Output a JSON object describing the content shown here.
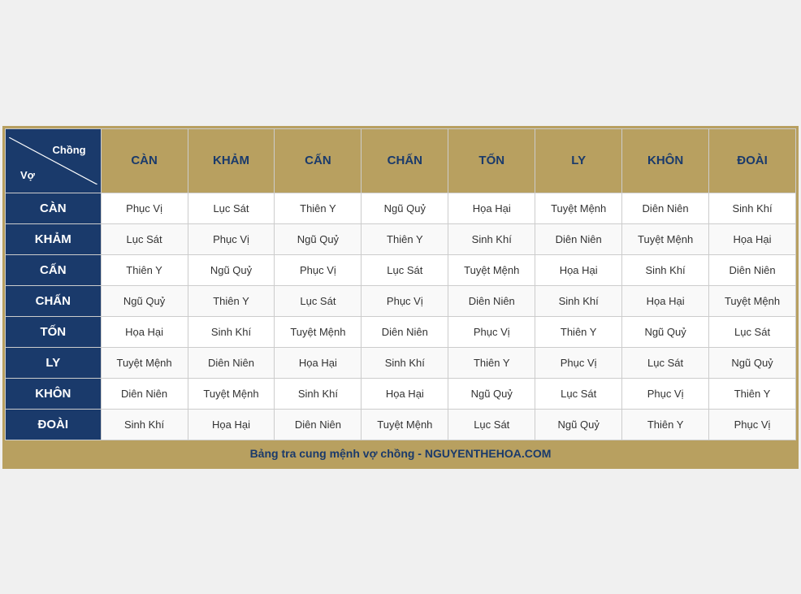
{
  "table": {
    "corner_label_chong": "Chồng",
    "corner_label_vo": "Vợ",
    "col_headers": [
      "CÀN",
      "KHẢM",
      "CẤN",
      "CHẤN",
      "TỐN",
      "LY",
      "KHÔN",
      "ĐOÀI"
    ],
    "row_headers": [
      "CÀN",
      "KHẢM",
      "CẤN",
      "CHẤN",
      "TỐN",
      "LY",
      "KHÔN",
      "ĐOÀI"
    ],
    "rows": [
      [
        "Phục Vị",
        "Lục Sát",
        "Thiên Y",
        "Ngũ Quỷ",
        "Họa Hại",
        "Tuyệt Mệnh",
        "Diên Niên",
        "Sinh Khí"
      ],
      [
        "Lục Sát",
        "Phục Vị",
        "Ngũ Quỷ",
        "Thiên Y",
        "Sinh Khí",
        "Diên Niên",
        "Tuyệt Mệnh",
        "Họa Hại"
      ],
      [
        "Thiên Y",
        "Ngũ Quỷ",
        "Phục Vị",
        "Lục Sát",
        "Tuyệt Mệnh",
        "Họa Hại",
        "Sinh Khí",
        "Diên Niên"
      ],
      [
        "Ngũ Quỷ",
        "Thiên Y",
        "Lục Sát",
        "Phục Vị",
        "Diên Niên",
        "Sinh Khí",
        "Họa Hại",
        "Tuyệt Mệnh"
      ],
      [
        "Họa Hại",
        "Sinh Khí",
        "Tuyệt Mệnh",
        "Diên Niên",
        "Phục Vị",
        "Thiên Y",
        "Ngũ Quỷ",
        "Lục Sát"
      ],
      [
        "Tuyệt Mệnh",
        "Diên Niên",
        "Họa Hại",
        "Sinh Khí",
        "Thiên Y",
        "Phục Vị",
        "Lục Sát",
        "Ngũ Quỷ"
      ],
      [
        "Diên Niên",
        "Tuyệt Mệnh",
        "Sinh Khí",
        "Họa Hại",
        "Ngũ Quỷ",
        "Lục Sát",
        "Phục Vị",
        "Thiên Y"
      ],
      [
        "Sinh Khí",
        "Họa Hại",
        "Diên Niên",
        "Tuyệt Mệnh",
        "Lục Sát",
        "Ngũ Quỷ",
        "Thiên Y",
        "Phục Vị"
      ]
    ]
  },
  "footer": {
    "text": "Bảng tra cung mệnh vợ chồng - NGUYENTHEHOA.COM"
  }
}
